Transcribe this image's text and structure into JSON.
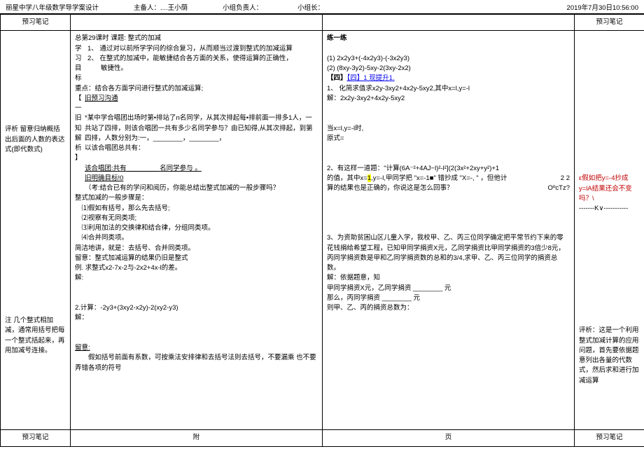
{
  "header": {
    "school_title": "丽星中学八年级数学导学案设计",
    "host_label": "主备人：",
    "host_value": "....王小荫",
    "group_leader_label": "小组负责人：",
    "group_head_label": "小组长：",
    "timestamp": "2019年7月30日10:56:00"
  },
  "notes_header_left": "预习笔记",
  "notes_header_right": "预习笔记",
  "col1": {
    "analysis": "评析 留意归纳概括出后面的人数的表达式(即代数式)",
    "note": "注 几个整式相加减，通常用括号把每一个整式括起来，再用加减号连接。"
  },
  "col2": {
    "topline": "总第29课时            课题: 整式的加减",
    "goals_label": "学习目标",
    "goals1": "1、 通过对以前所学学问的综合复习，从而顺当过渡到整式的加减运算",
    "goals2": "2、 在整式的加减中，能敏捷结合各方面的关系，使得运算的正确性，",
    "goals3": "　　敏捷性。",
    "keypoint": "重点：结合各方面学问进行整式的加减运算;",
    "box_marks": "【 一 旧 知 解 析 】",
    "preview_title": "旧预习沟通",
    "choir1": "*某中学合唱团出场时第•排站了n名同学，从其次排起每•排前面一排多1人，一共站了四排，则该合唱团一共有多少名同学参与？由已知得,从其次排起，到第四排，人数分别为:一，________，________，",
    "choir2": "以该合唱团总共有：",
    "choir3": "该合唱团:共有 ________ 名同学参与 。",
    "clarify_title": "旧明确目标!0",
    "think": "（考:结合已有的学问和阅历，你能总结出整式加减的一般步骤吗？",
    "steps_title": "整式加减的一般步骤是：",
    "step1": "⑴假如有括号，那么先去括号;",
    "step2": "⑵视察有无同类项;",
    "step3": "⑶利用加法的交换律和结合律，分组同类项。",
    "step4": "⑷合并同类项。",
    "summary1": "简洁地讲，就是：去括号、合并同类项。",
    "summary2": "留意：整式加减运算的结果仍旧是整式",
    "ex1": "例. 求整式x2-7x-2与-2x2+4x-l的差。",
    "ex1_ans": "解:",
    "ex2": "2.计算：-2y3+(3xy2-x2y)-2(xy2-y3)",
    "ex2_ans": "解：",
    "note_end_label": "留意:",
    "note_end": "　　假如括号前面有系数，可按乘法安排律和去括号法则去括号，不要漏乘 也不要弄错各项的符号"
  },
  "col3": {
    "practice_title": "练一练",
    "p1": "(1) 2x2y3+(-4x2y3)-(-3x2y3)",
    "p2": "(2) (8xy-3y2)-5xy-2(3xy-2x2)",
    "box4": "【四】1 现提升1.",
    "q1": "1、 化简求值求x2y-3xy2+4x2y-5xy2,其中x=l,y=-l",
    "q1sol": "解：2x2y-3xy2+4x2y-5xy2",
    "when": "当x=l,y=-l时,",
    "orig": "原式=",
    "q2": "2、有这样一道题：\"计算(6A⁻²+4AJ−l)²-l²](2(3x²+2xy+y²)+1",
    "q2b": "的值，其中x=",
    "q2b_hl": "1",
    "q2c": ",y=-l,甲同学把 \"x=-1■\" 错抄成 \"X=-, \" ，但他计",
    "q2d": "2      2",
    "q2e": "算的结果也是正确的，你说这是怎么回事？",
    "q2f": "OºcTz?",
    "q3a": "3、为资助贫困山区儿童入学，我校甲、乙、丙三位同学确定把平常节约下来的零花钱捐给希望工程，已知甲同学捐资X元，乙同学捐资比甲同学捐资的3倍少8元，丙同学捐资数是甲和乙同学捐资数的总和的3/4,求甲、乙、丙三位同学的捐资总数。",
    "q3b": "解：依据题意，知",
    "q3c": "甲同学捐资X元，乙同学捐资 ________ 元",
    "q3d": "那么，丙同学捐资 ________ 元",
    "q3e": "则甲、乙、丙的捐资总数为："
  },
  "col4": {
    "red_note1": "ε假如把y=-4抄成y=lA结果还会不变吗？\\",
    "dash": "-------K∨-----------",
    "analysis2": "评析：这是一个利用整式加减计算的应用问题，首先要依据题意列出各量的代数式，然后求和进行加减运算"
  },
  "footer": {
    "note_left": "预习笔记",
    "page_mid1": "附",
    "page_mid2": "页",
    "note_right": "预习笔记"
  }
}
